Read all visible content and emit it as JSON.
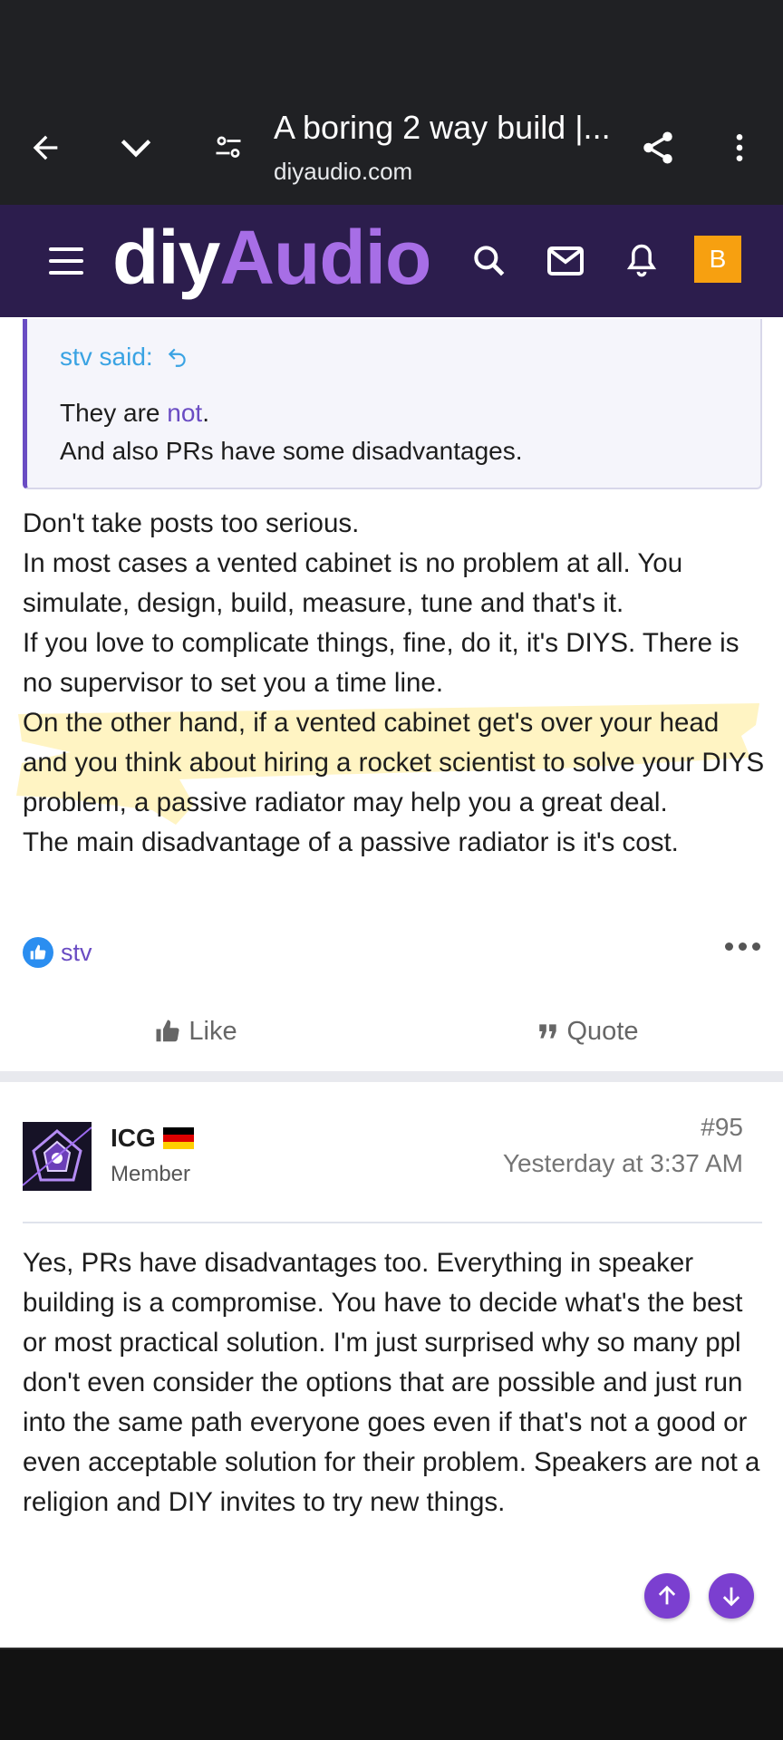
{
  "browser": {
    "page_title": "A boring 2 way build |...",
    "url": "diyaudio.com"
  },
  "site": {
    "logo_part1": "diy",
    "logo_part2": "Audio",
    "avatar_letter": "B",
    "brand_color": "#2c1d4d",
    "accent_color": "#a76ee6"
  },
  "quote": {
    "author": "stv said:",
    "line1_prefix": "They are ",
    "line1_link": "not",
    "line1_suffix": ".",
    "line2": "And also PRs have some disadvantages."
  },
  "post1": {
    "paragraphs": [
      "Don't take posts too serious.",
      "In most cases a vented cabinet is no problem at all. You simulate, design, build, measure, tune and that's it.",
      "If you love to complicate things, fine, do it, it's DIYS. There is no supervisor to set you a time line.",
      "On the other hand, if a vented cabinet get's over your head and you think about hiring a rocket scientist to solve your DIYS problem, a passive radiator may help you a great deal.",
      "The main disadvantage of a passive radiator is it's cost."
    ],
    "reaction_user": "stv",
    "like_label": "Like",
    "quote_label": "Quote"
  },
  "post2": {
    "username": "ICG",
    "role": "Member",
    "number": "#95",
    "time": "Yesterday at 3:37 AM",
    "body": "Yes, PRs have disadvantages too. Everything in speaker building is a compromise. You have to decide what's the best or most practical solution. I'm just surprised why so many ppl don't even consider the options that are possible and just run into the same path everyone goes even if that's not a good or even acceptable solution for their problem. Speakers are not a religion and DIY invites to try new things."
  },
  "icons": {
    "back": "back-arrow-icon",
    "tabs": "chevron-down-icon",
    "site_settings": "tune-icon",
    "share": "share-icon",
    "overflow": "more-vert-icon",
    "menu": "hamburger-icon",
    "search": "search-icon",
    "mail": "mail-icon",
    "alerts": "bell-icon"
  }
}
